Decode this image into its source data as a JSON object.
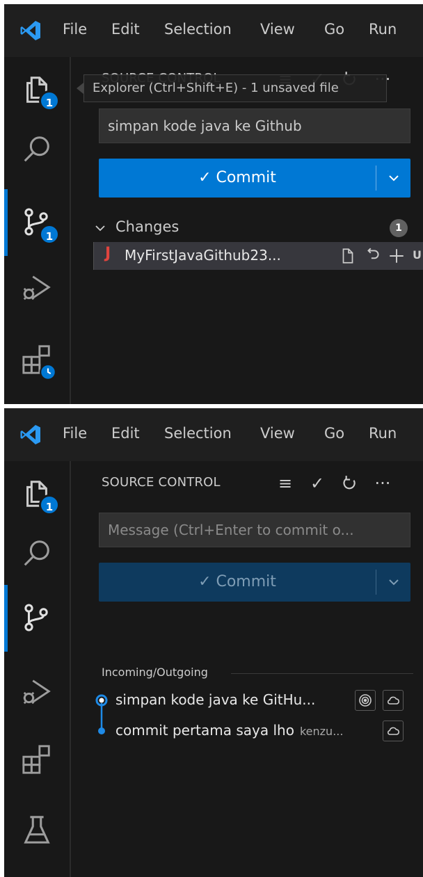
{
  "menu": [
    "File",
    "Edit",
    "Selection",
    "View",
    "Go",
    "Run"
  ],
  "activity_badges": {
    "explorer": "1",
    "source_control": "1"
  },
  "colors": {
    "accent": "#0078d4",
    "java": "#e0443e",
    "background": "#181818"
  },
  "panel1": {
    "title": "SOURCE CONTROL",
    "tooltip": "Explorer (Ctrl+Shift+E) - 1 unsaved file",
    "message_value": "simpan kode java ke Github",
    "commit_label": "✓ Commit",
    "changes_label": "Changes",
    "changes_count": "1",
    "file": {
      "icon": "J",
      "name": "MyFirstJavaGithub23...",
      "status": "U"
    }
  },
  "panel2": {
    "title": "SOURCE CONTROL",
    "message_placeholder": "Message (Ctrl+Enter to commit o...",
    "commit_label": "✓ Commit",
    "section_header": "Incoming/Outgoing",
    "commits": [
      {
        "message": "simpan kode java ke GitHu...",
        "author": ""
      },
      {
        "message": "commit pertama saya lho",
        "author": "kenzu..."
      }
    ]
  }
}
